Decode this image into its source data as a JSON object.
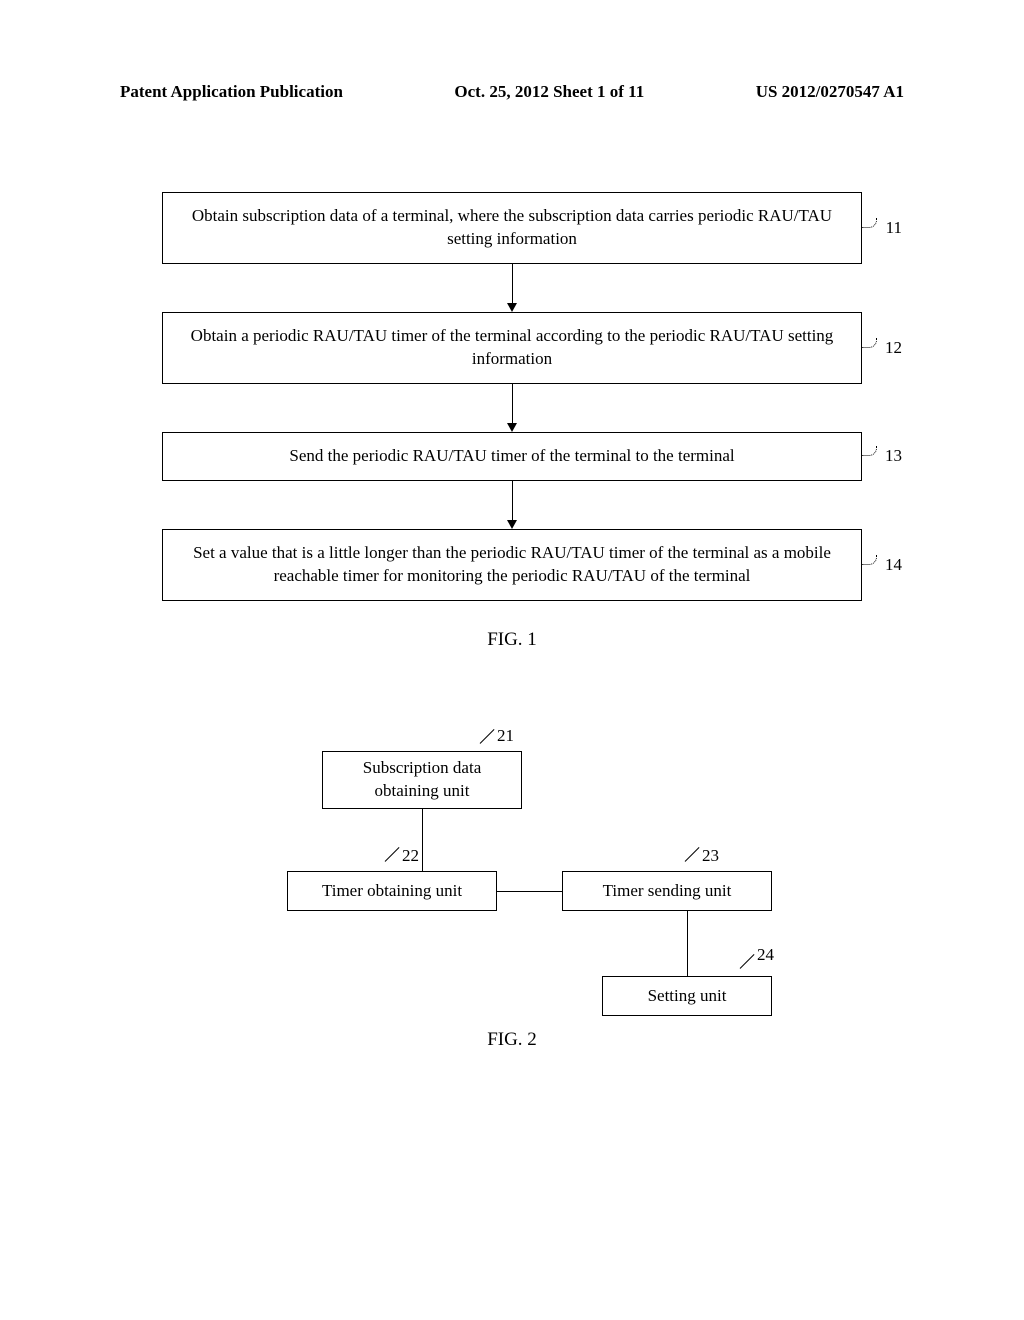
{
  "header": {
    "left": "Patent Application Publication",
    "center": "Oct. 25, 2012  Sheet 1 of 11",
    "right": "US 2012/0270547 A1"
  },
  "fig1": {
    "caption": "FIG. 1",
    "steps": [
      {
        "num": "11",
        "text": "Obtain subscription data of a terminal, where the subscription data carries periodic RAU/TAU setting information"
      },
      {
        "num": "12",
        "text": "Obtain a periodic RAU/TAU timer of the terminal according to the periodic RAU/TAU setting information"
      },
      {
        "num": "13",
        "text": "Send the periodic RAU/TAU timer of the terminal to the terminal"
      },
      {
        "num": "14",
        "text": "Set a value that is a little longer than the periodic RAU/TAU timer of the terminal as a mobile reachable timer for monitoring the periodic RAU/TAU of the terminal"
      }
    ]
  },
  "fig2": {
    "caption": "FIG. 2",
    "blocks": {
      "b21": {
        "num": "21",
        "label": "Subscription data obtaining unit"
      },
      "b22": {
        "num": "22",
        "label": "Timer obtaining unit"
      },
      "b23": {
        "num": "23",
        "label": "Timer sending unit"
      },
      "b24": {
        "num": "24",
        "label": "Setting unit"
      }
    }
  }
}
